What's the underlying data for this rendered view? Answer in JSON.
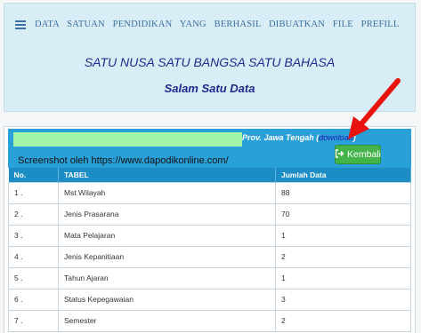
{
  "nav": {
    "icon": "list-icon",
    "text": "DATA SATUAN PENDIDIKAN YANG BERHASIL DIBUATKAN FILE PREFILL"
  },
  "slogan": "SATU NUSA SATU BANGSA SATU BAHASA",
  "greeting": "Salam Satu Data",
  "header": {
    "prov_label": "Prov. Jawa Tengah (",
    "download_label": "download",
    "prov_close": ")",
    "screenshot_note": "Screenshot oleh https://www.dapodikonline.com/",
    "back_button": "Kembali"
  },
  "table": {
    "columns": [
      "No.",
      "TABEL",
      "Jumlah Data"
    ],
    "rows": [
      {
        "no": "1 .",
        "tabel": "Mst Wilayah",
        "jumlah": "88"
      },
      {
        "no": "2 .",
        "tabel": "Jenis Prasarana",
        "jumlah": "70"
      },
      {
        "no": "3 .",
        "tabel": "Mata Pelajaran",
        "jumlah": "1"
      },
      {
        "no": "4 .",
        "tabel": "Jenis Kepanitiaan",
        "jumlah": "2"
      },
      {
        "no": "5 .",
        "tabel": "Tahun Ajaran",
        "jumlah": "1"
      },
      {
        "no": "6 .",
        "tabel": "Status Kepegawaian",
        "jumlah": "3"
      },
      {
        "no": "7 .",
        "tabel": "Semester",
        "jumlah": "2"
      }
    ]
  },
  "colors": {
    "panel_bg": "#d9edf7",
    "header_blue": "#2aa0d8",
    "button_green": "#44b34a",
    "arrow_red": "#e8130c"
  }
}
